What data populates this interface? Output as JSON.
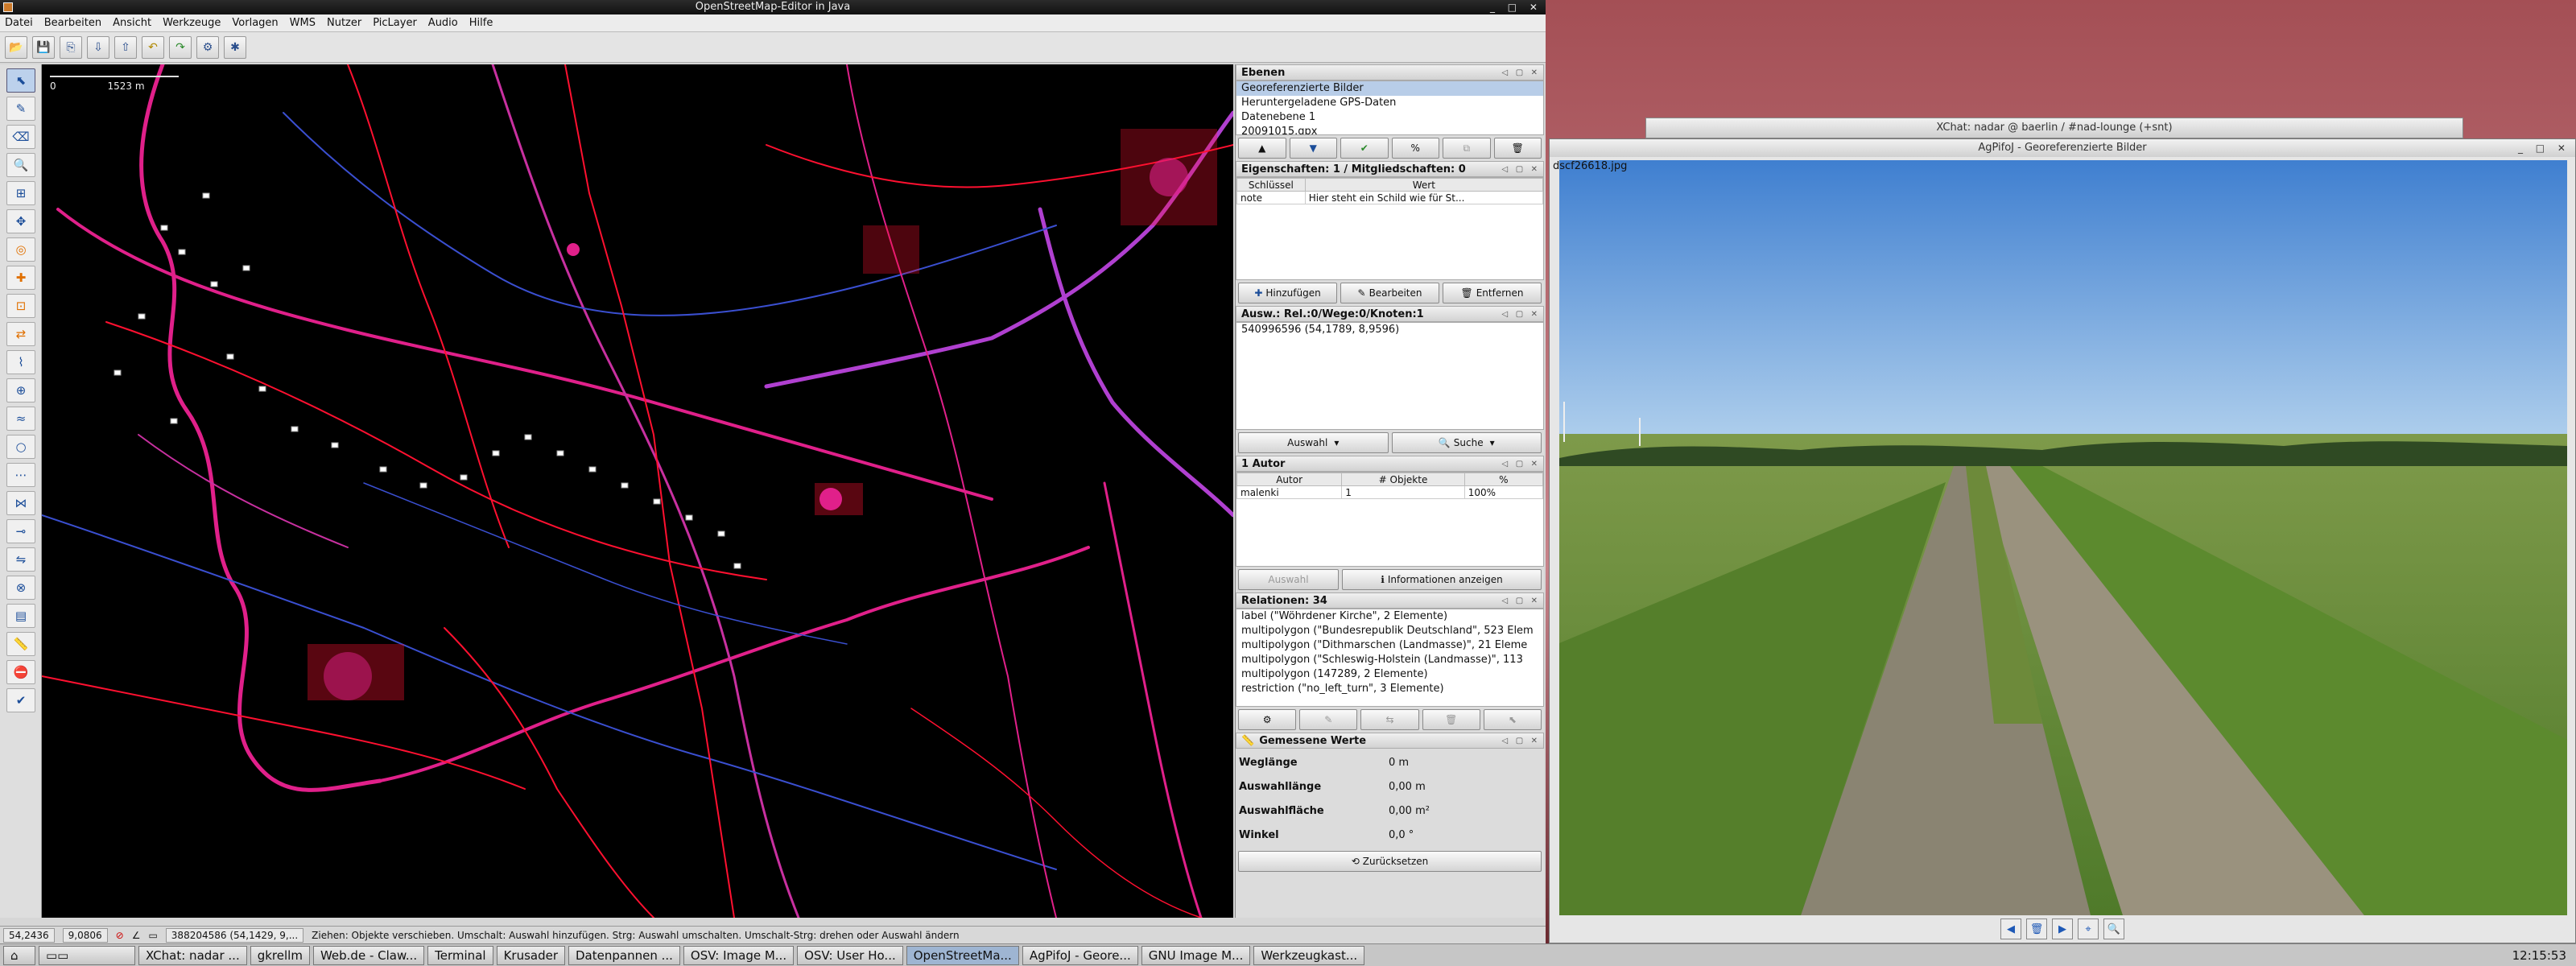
{
  "josm": {
    "title": "OpenStreetMap-Editor in Java",
    "menu": [
      "Datei",
      "Bearbeiten",
      "Ansicht",
      "Werkzeuge",
      "Vorlagen",
      "WMS",
      "Nutzer",
      "PicLayer",
      "Audio",
      "Hilfe"
    ],
    "scale": {
      "zero": "0",
      "distance": "1523 m"
    },
    "layers": {
      "title": "Ebenen",
      "items": [
        "Georeferenzierte Bilder",
        "Heruntergeladene GPS-Daten",
        "Datenebene 1",
        "20091015.gpx"
      ]
    },
    "properties": {
      "title": "Eigenschaften: 1 / Mitgliedschaften: 0",
      "col_key": "Schlüssel",
      "col_value": "Wert",
      "rows": [
        {
          "key": "note",
          "value": "Hier steht ein Schild wie für St..."
        }
      ],
      "add": "Hinzufügen",
      "edit": "Bearbeiten",
      "remove": "Entfernen"
    },
    "selection": {
      "title": "Ausw.: Rel.:0/Wege:0/Knoten:1",
      "items": [
        "540996596 (54,1789, 8,9596)"
      ],
      "select": "Auswahl",
      "search": "Suche"
    },
    "authors": {
      "title": "1 Autor",
      "col_author": "Autor",
      "col_objects": "# Objekte",
      "col_pct": "%",
      "rows": [
        {
          "author": "malenki",
          "objects": "1",
          "pct": "100%"
        }
      ],
      "select": "Auswahl",
      "info": "Informationen anzeigen"
    },
    "relations": {
      "title": "Relationen: 34",
      "items": [
        "label (\"Wöhrdener Kirche\", 2 Elemente)",
        "multipolygon (\"Bundesrepublik Deutschland\", 523 Elem",
        "multipolygon (\"Dithmarschen (Landmasse)\", 21 Eleme",
        "multipolygon (\"Schleswig-Holstein (Landmasse)\", 113",
        "multipolygon (147289, 2 Elemente)",
        "restriction (\"no_left_turn\", 3 Elemente)"
      ]
    },
    "measured": {
      "title": "Gemessene Werte",
      "rows": [
        {
          "label": "Weglänge",
          "value": "0 m"
        },
        {
          "label": "Auswahllänge",
          "value": "0,00 m"
        },
        {
          "label": "Auswahlfläche",
          "value": "0,00 m²"
        },
        {
          "label": "Winkel",
          "value": "0,0 °"
        }
      ],
      "reset": "Zurücksetzen"
    },
    "status": {
      "lat": "54,2436",
      "lon": "9,0806",
      "id": "388204586 (54,1429, 9,...",
      "hint": "Ziehen: Objekte verschieben. Umschalt: Auswahl hinzufügen. Strg: Auswahl umschalten. Umschalt-Strg: drehen oder Auswahl ändern"
    }
  },
  "xchat": {
    "title": "XChat: nadar @ baerlin / #nad-lounge (+snt)"
  },
  "image_viewer": {
    "title": "AgPifoJ - Georeferenzierte Bilder",
    "filename": "dscf26618.jpg"
  },
  "taskbar": {
    "tasks": [
      "XChat: nadar ...",
      "gkrellm",
      "Web.de - Claw...",
      "Terminal",
      "Krusader",
      "Datenpannen ...",
      "OSV: Image M...",
      "OSV: User Ho...",
      "OpenStreetMa...",
      "AgPifoJ - Geore...",
      "GNU Image M...",
      "Werkzeugkast..."
    ],
    "clock": "12:15:53"
  },
  "colors": {
    "map_bg": "#000000",
    "road_magenta": "#e0208a",
    "road_red": "#ff1030",
    "waterway_blue": "#3a4fd0"
  }
}
